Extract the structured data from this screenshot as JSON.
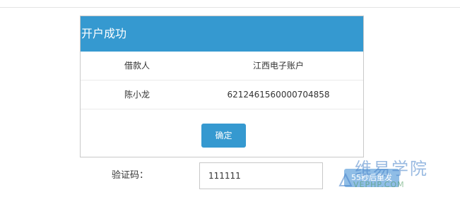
{
  "dialog": {
    "title": "开户成功",
    "table": {
      "headers": [
        "借款人",
        "江西电子账户"
      ],
      "rows": [
        [
          "陈小龙",
          "6212461560000704858"
        ]
      ]
    },
    "confirm_label": "确定"
  },
  "verification": {
    "label": "验证码：",
    "input_value": "111111",
    "resend_label": "55秒后重发"
  },
  "watermark": {
    "main_text": "维易学院",
    "sub_text": "VEPHP.COM"
  },
  "colors": {
    "header_blue": "#3599d0",
    "resend_blue": "#8fbde6"
  }
}
